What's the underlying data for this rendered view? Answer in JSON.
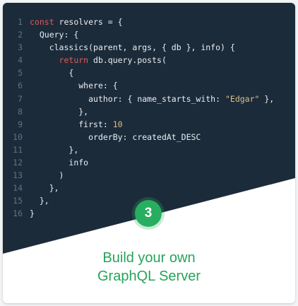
{
  "step_badge": "3",
  "card_title": [
    "Build your own",
    "GraphQL Server"
  ],
  "colors": {
    "code_bg": "#1c2b3a",
    "accent_green": "#27ae60",
    "title_green": "#27a35a",
    "keyword": "#e05a5a",
    "string": "#d7c08a",
    "line_number": "#5f7281"
  },
  "code_lines": [
    {
      "n": "1",
      "indent": "",
      "tokens": [
        {
          "t": "kw",
          "v": "const"
        },
        {
          "t": "plain",
          "v": " resolvers = {"
        }
      ]
    },
    {
      "n": "2",
      "indent": "  ",
      "tokens": [
        {
          "t": "plain",
          "v": "Query: {"
        }
      ]
    },
    {
      "n": "3",
      "indent": "    ",
      "tokens": [
        {
          "t": "plain",
          "v": "classics(parent, args, { db }, info) {"
        }
      ]
    },
    {
      "n": "4",
      "indent": "      ",
      "tokens": [
        {
          "t": "kw",
          "v": "return"
        },
        {
          "t": "plain",
          "v": " db.query.posts("
        }
      ]
    },
    {
      "n": "5",
      "indent": "        ",
      "tokens": [
        {
          "t": "plain",
          "v": "{"
        }
      ]
    },
    {
      "n": "6",
      "indent": "          ",
      "tokens": [
        {
          "t": "plain",
          "v": "where: {"
        }
      ]
    },
    {
      "n": "7",
      "indent": "            ",
      "tokens": [
        {
          "t": "plain",
          "v": "author: { name_starts_with: "
        },
        {
          "t": "str",
          "v": "\"Edgar\""
        },
        {
          "t": "plain",
          "v": " },"
        }
      ]
    },
    {
      "n": "8",
      "indent": "          ",
      "tokens": [
        {
          "t": "plain",
          "v": "},"
        }
      ]
    },
    {
      "n": "9",
      "indent": "          ",
      "tokens": [
        {
          "t": "plain",
          "v": "first: "
        },
        {
          "t": "num",
          "v": "10"
        }
      ]
    },
    {
      "n": "10",
      "indent": "            ",
      "tokens": [
        {
          "t": "plain",
          "v": "orderBy: createdAt_DESC"
        }
      ]
    },
    {
      "n": "11",
      "indent": "        ",
      "tokens": [
        {
          "t": "plain",
          "v": "},"
        }
      ]
    },
    {
      "n": "12",
      "indent": "        ",
      "tokens": [
        {
          "t": "plain",
          "v": "info"
        }
      ]
    },
    {
      "n": "13",
      "indent": "      ",
      "tokens": [
        {
          "t": "plain",
          "v": ")"
        }
      ]
    },
    {
      "n": "14",
      "indent": "    ",
      "tokens": [
        {
          "t": "plain",
          "v": "},"
        }
      ]
    },
    {
      "n": "15",
      "indent": "  ",
      "tokens": [
        {
          "t": "plain",
          "v": "},"
        }
      ]
    },
    {
      "n": "16",
      "indent": "",
      "tokens": [
        {
          "t": "plain",
          "v": "}"
        }
      ]
    }
  ]
}
